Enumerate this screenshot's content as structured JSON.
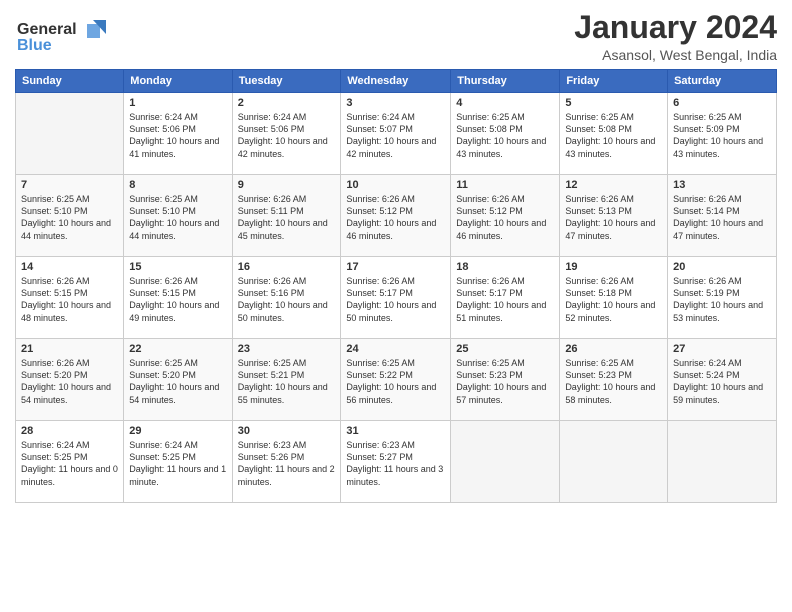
{
  "logo": {
    "line1": "General",
    "line2": "Blue"
  },
  "title": "January 2024",
  "subtitle": "Asansol, West Bengal, India",
  "weekdays": [
    "Sunday",
    "Monday",
    "Tuesday",
    "Wednesday",
    "Thursday",
    "Friday",
    "Saturday"
  ],
  "weeks": [
    [
      {
        "day": "",
        "sunrise": "",
        "sunset": "",
        "daylight": ""
      },
      {
        "day": "1",
        "sunrise": "Sunrise: 6:24 AM",
        "sunset": "Sunset: 5:06 PM",
        "daylight": "Daylight: 10 hours and 41 minutes."
      },
      {
        "day": "2",
        "sunrise": "Sunrise: 6:24 AM",
        "sunset": "Sunset: 5:06 PM",
        "daylight": "Daylight: 10 hours and 42 minutes."
      },
      {
        "day": "3",
        "sunrise": "Sunrise: 6:24 AM",
        "sunset": "Sunset: 5:07 PM",
        "daylight": "Daylight: 10 hours and 42 minutes."
      },
      {
        "day": "4",
        "sunrise": "Sunrise: 6:25 AM",
        "sunset": "Sunset: 5:08 PM",
        "daylight": "Daylight: 10 hours and 43 minutes."
      },
      {
        "day": "5",
        "sunrise": "Sunrise: 6:25 AM",
        "sunset": "Sunset: 5:08 PM",
        "daylight": "Daylight: 10 hours and 43 minutes."
      },
      {
        "day": "6",
        "sunrise": "Sunrise: 6:25 AM",
        "sunset": "Sunset: 5:09 PM",
        "daylight": "Daylight: 10 hours and 43 minutes."
      }
    ],
    [
      {
        "day": "7",
        "sunrise": "Sunrise: 6:25 AM",
        "sunset": "Sunset: 5:10 PM",
        "daylight": "Daylight: 10 hours and 44 minutes."
      },
      {
        "day": "8",
        "sunrise": "Sunrise: 6:25 AM",
        "sunset": "Sunset: 5:10 PM",
        "daylight": "Daylight: 10 hours and 44 minutes."
      },
      {
        "day": "9",
        "sunrise": "Sunrise: 6:26 AM",
        "sunset": "Sunset: 5:11 PM",
        "daylight": "Daylight: 10 hours and 45 minutes."
      },
      {
        "day": "10",
        "sunrise": "Sunrise: 6:26 AM",
        "sunset": "Sunset: 5:12 PM",
        "daylight": "Daylight: 10 hours and 46 minutes."
      },
      {
        "day": "11",
        "sunrise": "Sunrise: 6:26 AM",
        "sunset": "Sunset: 5:12 PM",
        "daylight": "Daylight: 10 hours and 46 minutes."
      },
      {
        "day": "12",
        "sunrise": "Sunrise: 6:26 AM",
        "sunset": "Sunset: 5:13 PM",
        "daylight": "Daylight: 10 hours and 47 minutes."
      },
      {
        "day": "13",
        "sunrise": "Sunrise: 6:26 AM",
        "sunset": "Sunset: 5:14 PM",
        "daylight": "Daylight: 10 hours and 47 minutes."
      }
    ],
    [
      {
        "day": "14",
        "sunrise": "Sunrise: 6:26 AM",
        "sunset": "Sunset: 5:15 PM",
        "daylight": "Daylight: 10 hours and 48 minutes."
      },
      {
        "day": "15",
        "sunrise": "Sunrise: 6:26 AM",
        "sunset": "Sunset: 5:15 PM",
        "daylight": "Daylight: 10 hours and 49 minutes."
      },
      {
        "day": "16",
        "sunrise": "Sunrise: 6:26 AM",
        "sunset": "Sunset: 5:16 PM",
        "daylight": "Daylight: 10 hours and 50 minutes."
      },
      {
        "day": "17",
        "sunrise": "Sunrise: 6:26 AM",
        "sunset": "Sunset: 5:17 PM",
        "daylight": "Daylight: 10 hours and 50 minutes."
      },
      {
        "day": "18",
        "sunrise": "Sunrise: 6:26 AM",
        "sunset": "Sunset: 5:17 PM",
        "daylight": "Daylight: 10 hours and 51 minutes."
      },
      {
        "day": "19",
        "sunrise": "Sunrise: 6:26 AM",
        "sunset": "Sunset: 5:18 PM",
        "daylight": "Daylight: 10 hours and 52 minutes."
      },
      {
        "day": "20",
        "sunrise": "Sunrise: 6:26 AM",
        "sunset": "Sunset: 5:19 PM",
        "daylight": "Daylight: 10 hours and 53 minutes."
      }
    ],
    [
      {
        "day": "21",
        "sunrise": "Sunrise: 6:26 AM",
        "sunset": "Sunset: 5:20 PM",
        "daylight": "Daylight: 10 hours and 54 minutes."
      },
      {
        "day": "22",
        "sunrise": "Sunrise: 6:25 AM",
        "sunset": "Sunset: 5:20 PM",
        "daylight": "Daylight: 10 hours and 54 minutes."
      },
      {
        "day": "23",
        "sunrise": "Sunrise: 6:25 AM",
        "sunset": "Sunset: 5:21 PM",
        "daylight": "Daylight: 10 hours and 55 minutes."
      },
      {
        "day": "24",
        "sunrise": "Sunrise: 6:25 AM",
        "sunset": "Sunset: 5:22 PM",
        "daylight": "Daylight: 10 hours and 56 minutes."
      },
      {
        "day": "25",
        "sunrise": "Sunrise: 6:25 AM",
        "sunset": "Sunset: 5:23 PM",
        "daylight": "Daylight: 10 hours and 57 minutes."
      },
      {
        "day": "26",
        "sunrise": "Sunrise: 6:25 AM",
        "sunset": "Sunset: 5:23 PM",
        "daylight": "Daylight: 10 hours and 58 minutes."
      },
      {
        "day": "27",
        "sunrise": "Sunrise: 6:24 AM",
        "sunset": "Sunset: 5:24 PM",
        "daylight": "Daylight: 10 hours and 59 minutes."
      }
    ],
    [
      {
        "day": "28",
        "sunrise": "Sunrise: 6:24 AM",
        "sunset": "Sunset: 5:25 PM",
        "daylight": "Daylight: 11 hours and 0 minutes."
      },
      {
        "day": "29",
        "sunrise": "Sunrise: 6:24 AM",
        "sunset": "Sunset: 5:25 PM",
        "daylight": "Daylight: 11 hours and 1 minute."
      },
      {
        "day": "30",
        "sunrise": "Sunrise: 6:23 AM",
        "sunset": "Sunset: 5:26 PM",
        "daylight": "Daylight: 11 hours and 2 minutes."
      },
      {
        "day": "31",
        "sunrise": "Sunrise: 6:23 AM",
        "sunset": "Sunset: 5:27 PM",
        "daylight": "Daylight: 11 hours and 3 minutes."
      },
      {
        "day": "",
        "sunrise": "",
        "sunset": "",
        "daylight": ""
      },
      {
        "day": "",
        "sunrise": "",
        "sunset": "",
        "daylight": ""
      },
      {
        "day": "",
        "sunrise": "",
        "sunset": "",
        "daylight": ""
      }
    ]
  ]
}
